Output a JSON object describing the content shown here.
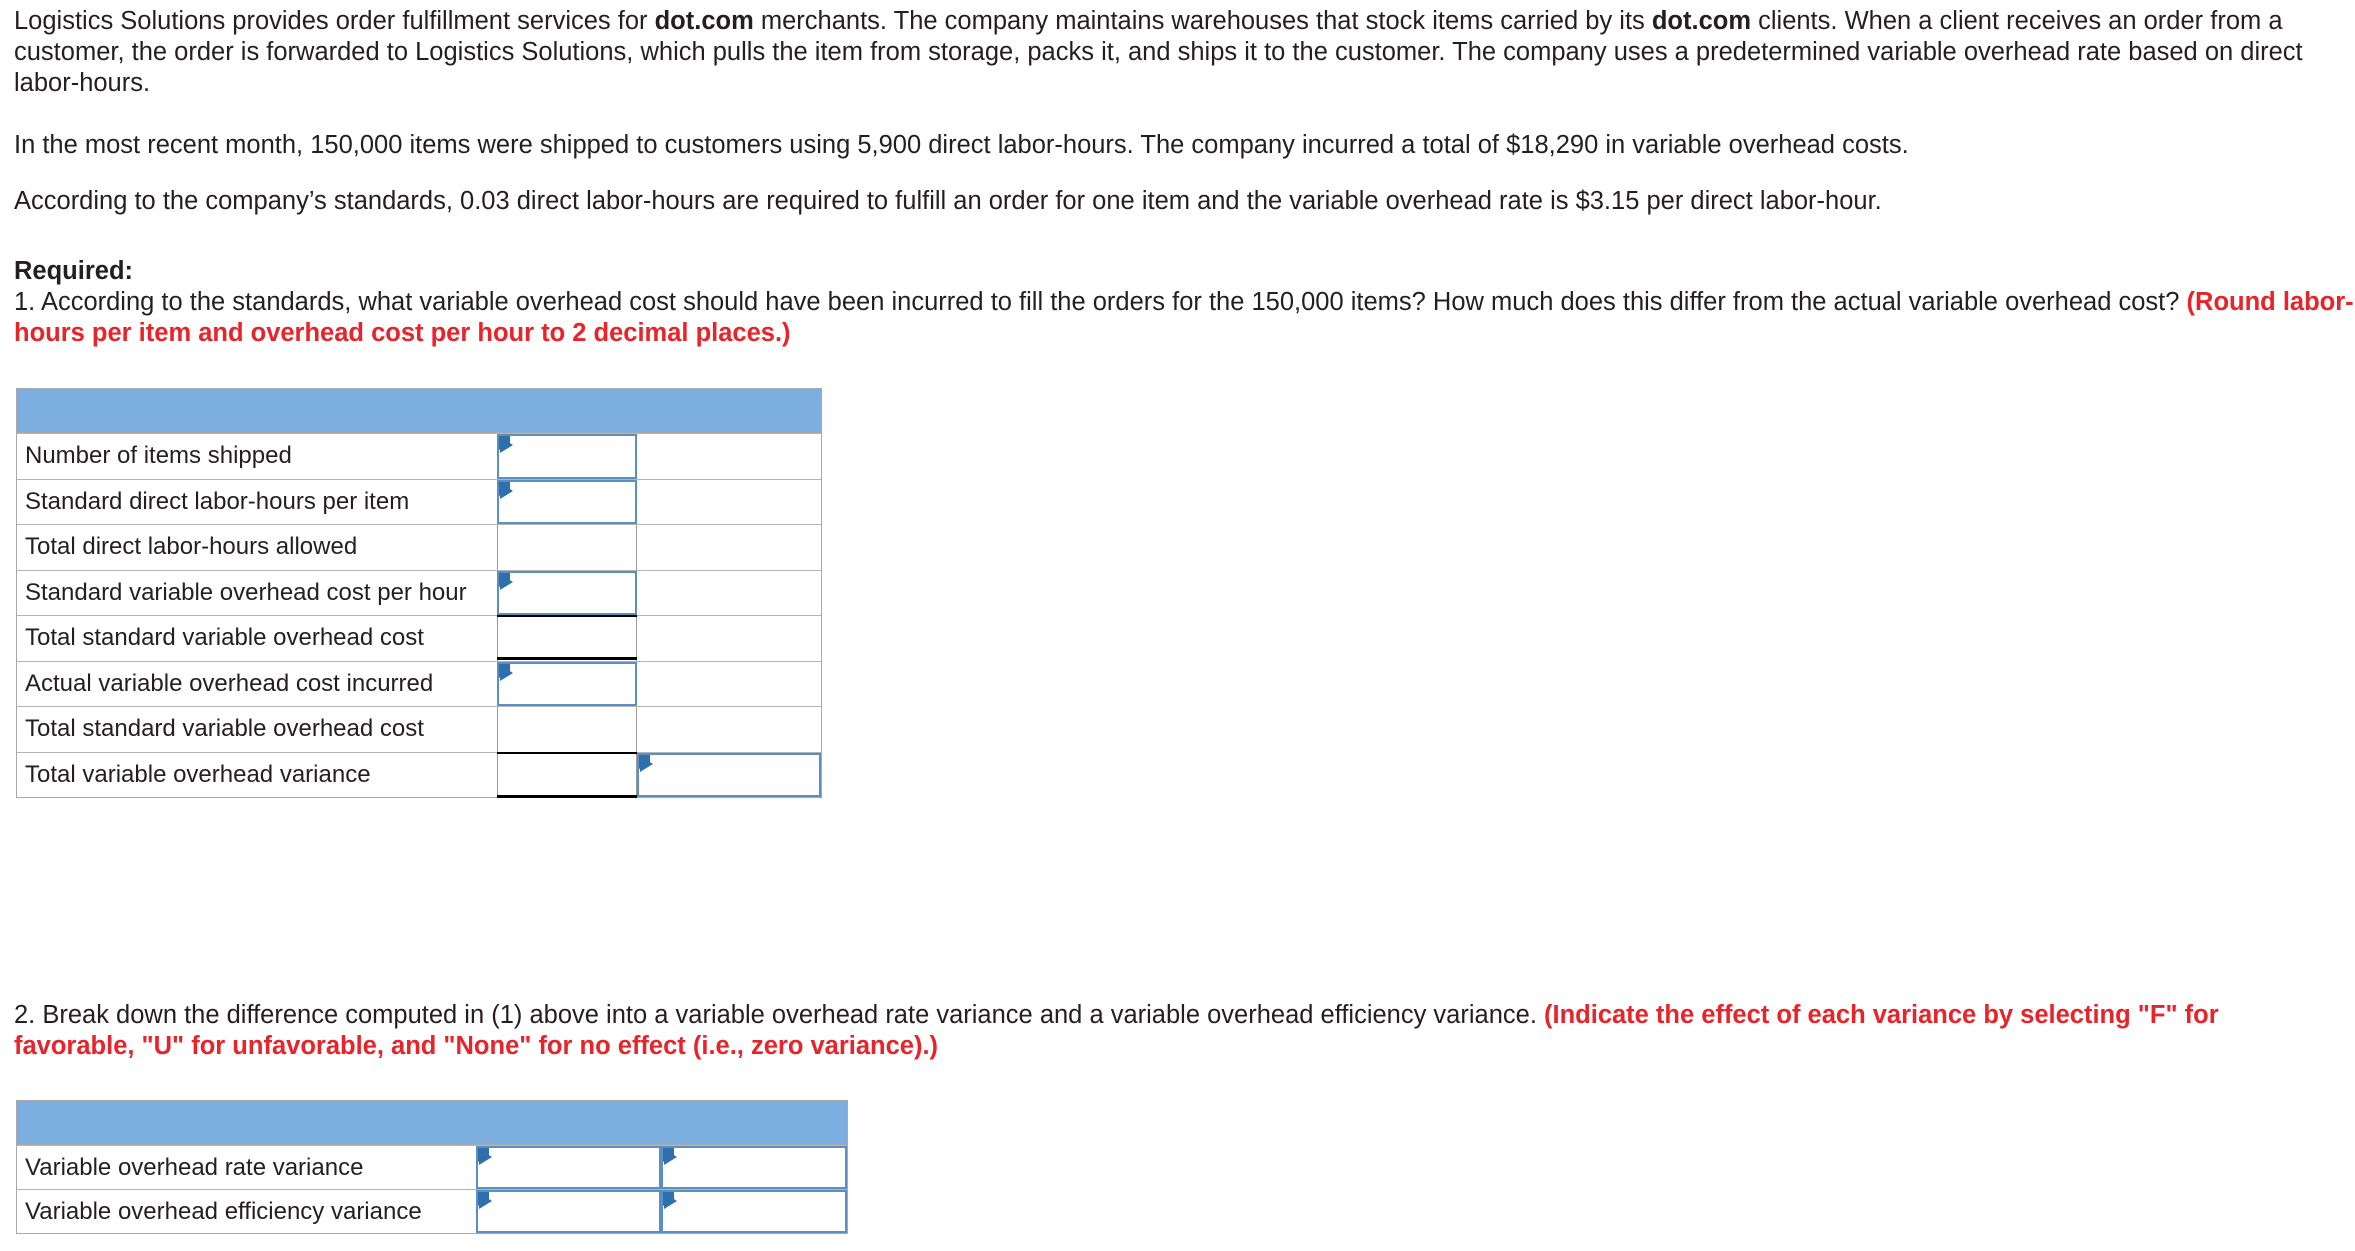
{
  "problem": {
    "intro_paragraph_parts": [
      {
        "text": "Logistics Solutions provides order fulfillment services for ",
        "bold": false
      },
      {
        "text": "dot.com",
        "bold": true
      },
      {
        "text": " merchants. The company maintains warehouses that stock items carried by its ",
        "bold": false
      },
      {
        "text": "dot.com",
        "bold": true
      },
      {
        "text": " clients. When a client receives an order from a customer, the order is forwarded to Logistics Solutions, which pulls the item from storage, packs it, and ships it to the customer. The company uses a predetermined variable overhead rate based on direct labor-hours.",
        "bold": false
      }
    ],
    "month_paragraph": "In the most recent month, 150,000 items were shipped to customers using 5,900 direct labor-hours. The company incurred a total of $18,290 in variable overhead costs.",
    "standards_paragraph": "According to the company’s standards, 0.03 direct labor-hours are required to fulfill an order for one item and the variable overhead rate is $3.15 per direct labor-hour.",
    "required_label": "Required:",
    "question1_text": "1. According to the standards, what variable overhead cost should have been incurred to fill the orders for the 150,000 items? How much does this differ from the actual variable overhead cost? ",
    "question1_instruction": "(Round labor-hours per item and overhead cost per hour to 2 decimal places.)",
    "question2_text": "2. Break down the difference computed in (1) above into a variable overhead rate variance and a variable overhead efficiency variance. ",
    "question2_instruction": "(Indicate the effect of each variance by selecting \"F\" for favorable, \"U\" for unfavorable, and \"None\" for no effect (i.e., zero variance).)"
  },
  "table1": {
    "header_label": "",
    "rows": [
      {
        "label": "Number of items shipped",
        "value": "",
        "kind": "input"
      },
      {
        "label": "Standard direct labor-hours per item",
        "value": "",
        "kind": "input"
      },
      {
        "label": "Total direct labor-hours allowed",
        "value": "",
        "kind": "plain"
      },
      {
        "label": "Standard variable overhead cost per hour",
        "value": "",
        "kind": "input"
      },
      {
        "label": "Total standard variable overhead cost",
        "value": "",
        "kind": "plain"
      },
      {
        "label": "Actual variable overhead cost incurred",
        "value": "",
        "kind": "input"
      },
      {
        "label": "Total standard variable overhead cost",
        "value": "",
        "kind": "plain"
      },
      {
        "label": "Total variable overhead variance",
        "value": "",
        "kind": "plain",
        "value2": "",
        "kind2": "input"
      }
    ]
  },
  "table2": {
    "header_label": "",
    "rows": [
      {
        "label": "Variable overhead rate variance",
        "value": "",
        "value2": ""
      },
      {
        "label": "Variable overhead efficiency variance",
        "value": "",
        "value2": ""
      }
    ]
  },
  "colors": {
    "header_blue": "#7cafe0",
    "input_border_blue": "#5a8fc0",
    "flag_blue": "#2f6fad",
    "instruction_red": "#e8232a",
    "grid_gray": "#a9a9a9"
  }
}
